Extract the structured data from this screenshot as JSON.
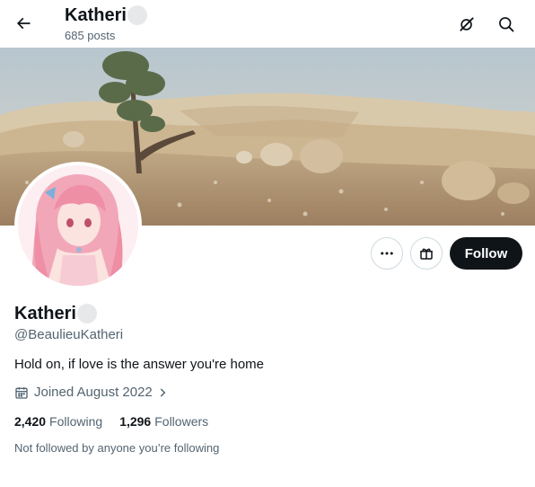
{
  "header": {
    "back_icon": "arrow-left-icon",
    "name": "Katheri",
    "posts_count": "685 posts",
    "grok_icon": "grok-icon",
    "search_icon": "search-icon"
  },
  "banner": {
    "image": "desert-hills-landscape-with-tree-and-rocks"
  },
  "avatar": {
    "image": "anime-girl-pink-hair-avatar"
  },
  "actions": {
    "more_icon": "more-dots-icon",
    "gift_icon": "gift-icon",
    "follow_label": "Follow"
  },
  "profile": {
    "display_name": "Katheri",
    "handle": "@BeaulieuKatheri",
    "bio": "Hold on, if love is the answer you're home",
    "joined": "Joined August 2022",
    "following_count": "2,420",
    "following_label": "Following",
    "followers_count": "1,296",
    "followers_label": "Followers",
    "not_followed_text": "Not followed by anyone you’re following"
  },
  "colors": {
    "primary_text": "#0f1419",
    "secondary_text": "#536471",
    "border": "#cfd9de",
    "follow_bg": "#0f1419"
  }
}
